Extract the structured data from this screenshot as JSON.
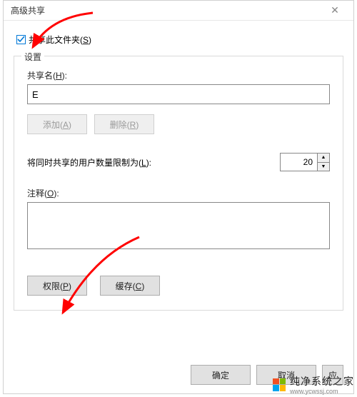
{
  "window": {
    "title": "高级共享",
    "close_glyph": "✕"
  },
  "share_checkbox": {
    "label_prefix": "共享此文件夹(",
    "accel": "S",
    "label_suffix": ")",
    "checked": true
  },
  "group": {
    "legend": "设置",
    "share_name_label_prefix": "共享名(",
    "share_name_accel": "H",
    "share_name_label_suffix": "):",
    "share_name_value": "E",
    "add_label_prefix": "添加(",
    "add_accel": "A",
    "add_label_suffix": ")",
    "remove_label_prefix": "删除(",
    "remove_accel": "R",
    "remove_label_suffix": ")",
    "limit_label_prefix": "将同时共享的用户数量限制为(",
    "limit_accel": "L",
    "limit_label_suffix": "):",
    "limit_value": "20",
    "comment_label_prefix": "注释(",
    "comment_accel": "O",
    "comment_label_suffix": "):",
    "comment_value": "",
    "perm_label_prefix": "权限(",
    "perm_accel": "P",
    "perm_label_suffix": ")",
    "cache_label_prefix": "缓存(",
    "cache_accel": "C",
    "cache_label_suffix": ")"
  },
  "buttons": {
    "ok": "确定",
    "cancel": "取消",
    "apply": "应"
  },
  "watermark": {
    "text": "纯净系统之家",
    "url": "www.ycwssj.com"
  }
}
